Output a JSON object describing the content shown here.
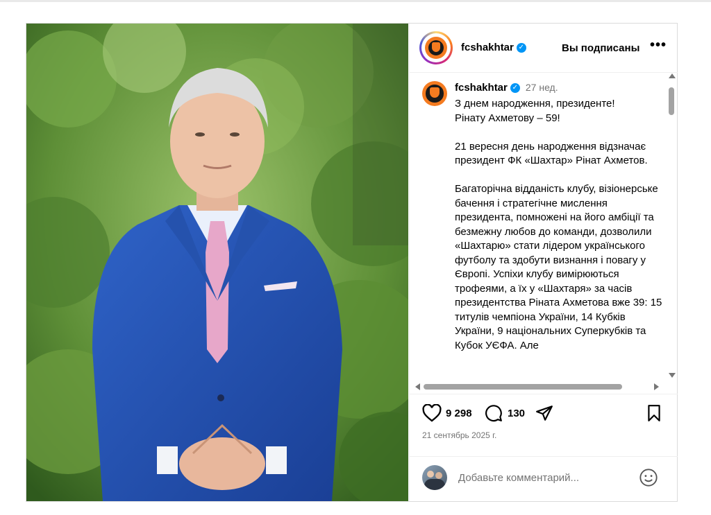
{
  "account": {
    "username": "fcshakhtar",
    "follow_status": "Вы подписаны",
    "more_label": "•••"
  },
  "caption": {
    "username": "fcshakhtar",
    "time": "27 нед.",
    "text": "З днем народження, президенте!\nРінату Ахметову – 59!\n\n21 вересня день народження відзначає президент ФК «Шахтар» Рінат Ахметов.\n\nБагаторічна відданість клубу, візіонерське бачення і стратегічне мислення президента, помножені на його амбіції та безмежну любов до команди, дозволили «Шахтарю» стати лідером українського футболу та здобути визнання і повагу у Європі. Успіхи клубу вимірюються трофеями, а їх у «Шахтаря» за часів президентства Ріната Ахметова вже 39: 15 титулів чемпіона України, 14 Кубків України, 9 національних Суперкубків та Кубок УЄФА. Але"
  },
  "stats": {
    "likes": "9 298",
    "comments": "130"
  },
  "date": "21 сентябрь 2025 г.",
  "comment_box": {
    "placeholder": "Добавьте комментарий..."
  },
  "colors": {
    "verified": "#0095f6",
    "crest_orange": "#f47b20",
    "muted": "#737373"
  },
  "icons": [
    "heart-icon",
    "comment-icon",
    "share-icon",
    "bookmark-icon",
    "emoji-icon",
    "verified-icon"
  ]
}
